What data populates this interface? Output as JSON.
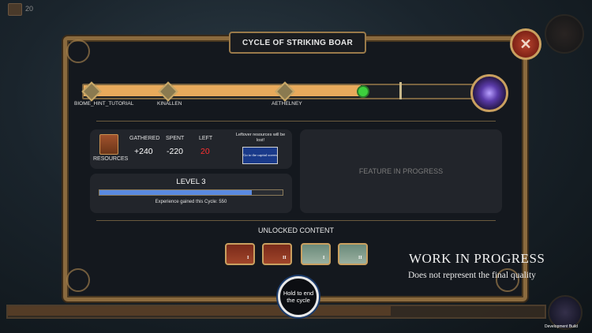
{
  "hud": {
    "count": "20"
  },
  "window": {
    "title": "CYCLE OF STRIKING BOAR",
    "close_glyph": "✕"
  },
  "track": {
    "progress": 0.69,
    "nodes": [
      {
        "label": "BIOME_HINT_TUTORIAL"
      },
      {
        "label": "KINALLEN"
      },
      {
        "label": "AETHELNEY"
      }
    ]
  },
  "resources": {
    "label": "RESOURCES",
    "gathered_label": "GATHERED",
    "gathered_value": "+240",
    "spent_label": "SPENT",
    "spent_value": "-220",
    "left_label": "LEFT",
    "left_value": "20",
    "warning": "Leftover resources will be lost!",
    "capital_button": "Go to the capital screen"
  },
  "level": {
    "title": "LEVEL 3",
    "xp_progress": 0.83,
    "xp_text": "Experience gained this Cycle: 550"
  },
  "feature": {
    "text": "FEATURE IN PROGRESS"
  },
  "unlocked": {
    "title": "UNLOCKED CONTENT",
    "cards": [
      {
        "numeral": "I",
        "color": "red"
      },
      {
        "numeral": "II",
        "color": "red"
      },
      {
        "numeral": "I",
        "color": "green"
      },
      {
        "numeral": "II",
        "color": "green"
      }
    ]
  },
  "hold_button": {
    "label": "Hold to end the cycle"
  },
  "watermark": {
    "title": "WORK IN PROGRESS",
    "subtitle": "Does not represent the final quality"
  },
  "dev_build": "Development Build",
  "colors": {
    "accent_gold": "#c9a060",
    "progress_orange": "#e8aa5c",
    "xp_blue": "#5a8ae0",
    "warning_red": "#ff3030"
  }
}
